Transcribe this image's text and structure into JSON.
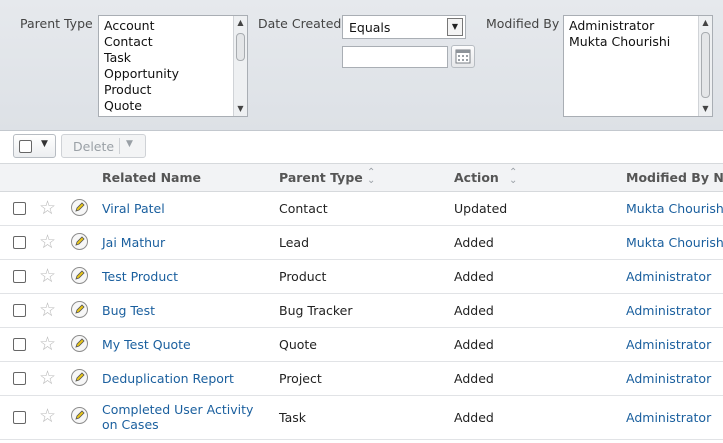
{
  "filters": {
    "parent_type": {
      "label": "Parent Type",
      "options": [
        "Account",
        "Contact",
        "Task",
        "Opportunity",
        "Product",
        "Quote"
      ]
    },
    "date_created": {
      "label": "Date Created",
      "operator": "Equals",
      "value": ""
    },
    "modified_by": {
      "label": "Modified By",
      "options": [
        "Administrator",
        "Mukta Chourishi"
      ]
    }
  },
  "actions": {
    "delete_label": "Delete"
  },
  "table": {
    "columns": {
      "related_name": "Related Name",
      "parent_type": "Parent Type",
      "action": "Action",
      "modified_by": "Modified By Name"
    },
    "rows": [
      {
        "related_name": "Viral Patel",
        "parent_type": "Contact",
        "action": "Updated",
        "modified_by": "Mukta Chourishi"
      },
      {
        "related_name": "Jai Mathur",
        "parent_type": "Lead",
        "action": "Added",
        "modified_by": "Mukta Chourishi"
      },
      {
        "related_name": "Test Product",
        "parent_type": "Product",
        "action": "Added",
        "modified_by": "Administrator"
      },
      {
        "related_name": "Bug Test",
        "parent_type": "Bug Tracker",
        "action": "Added",
        "modified_by": "Administrator"
      },
      {
        "related_name": "My Test Quote",
        "parent_type": "Quote",
        "action": "Added",
        "modified_by": "Administrator"
      },
      {
        "related_name": "Deduplication Report",
        "parent_type": "Project",
        "action": "Added",
        "modified_by": "Administrator"
      },
      {
        "related_name": "Completed User Activity on Cases",
        "parent_type": "Task",
        "action": "Added",
        "modified_by": "Administrator"
      }
    ]
  },
  "colors": {
    "link": "#1a5f9e",
    "header_bg": "#f2f3f5",
    "filter_bg": "#e2e5e9"
  }
}
